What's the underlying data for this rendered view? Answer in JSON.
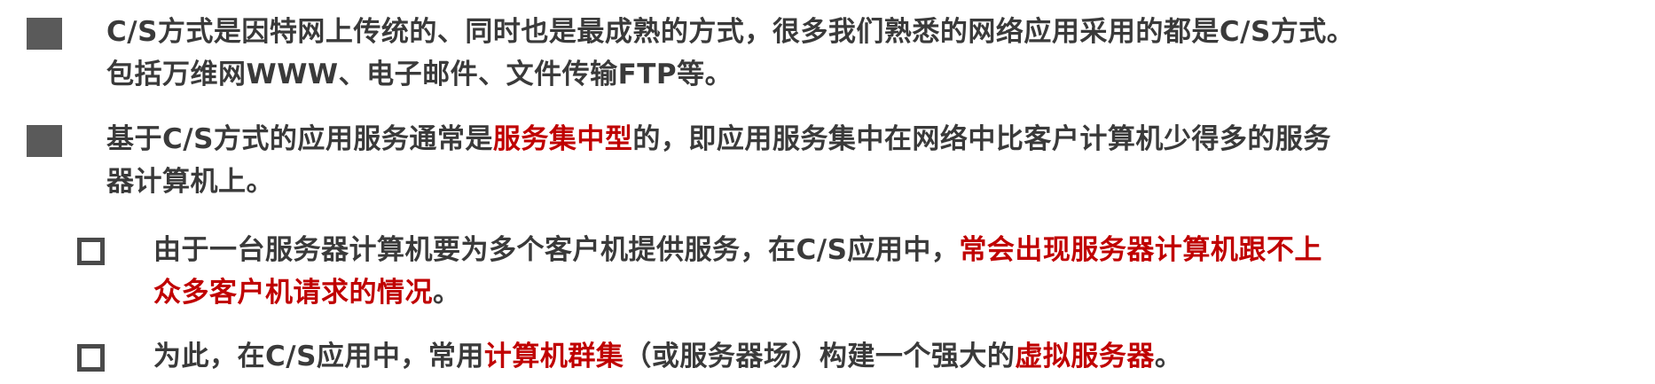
{
  "bullets": [
    {
      "line1": "C/S方式是因特网上传统的、同时也是最成熟的方式，很多我们熟悉的网络应用采用的都是C/S方式。",
      "line2": "包括万维网WWW、电子邮件、文件传输FTP等。"
    },
    {
      "p1": "基于C/S方式的应用服务通常是",
      "h1": "服务集中型",
      "p2": "的，即应用服务集中在网络中比客户计算机少得多的服务",
      "p3": "器计算机上。"
    }
  ],
  "subbullets": [
    {
      "p1": "由于一台服务器计算机要为多个客户机提供服务，在C/S应用中，",
      "h1": "常会出现服务器计算机跟不上",
      "h2": "众多客户机请求的情况",
      "p2": "。"
    },
    {
      "p1": "为此，在C/S应用中，常用",
      "h1": "计算机群集",
      "p2": "（或服务器场）构建一个强大的",
      "h2": "虚拟服务器",
      "p3": "。"
    }
  ],
  "colors": {
    "text": "#3a3a3a",
    "highlight": "#c00000",
    "bullet": "#5a5a5a"
  }
}
